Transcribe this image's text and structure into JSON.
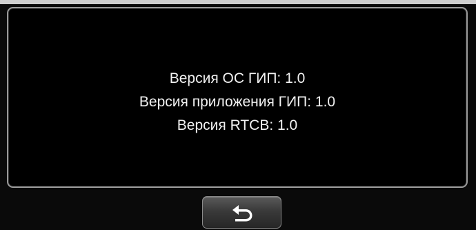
{
  "info": {
    "lines": [
      "Версия ОС ГИП: 1.0",
      "Версия приложения ГИП: 1.0",
      "Версия RTCB: 1.0"
    ]
  },
  "footer": {
    "back_button_icon": "back-arrow-icon"
  },
  "colors": {
    "background": "#000000",
    "panel_border": "#9a9a9a",
    "text": "#f2f2f2",
    "button_top": "#5a5a5a",
    "button_bottom": "#262626"
  }
}
